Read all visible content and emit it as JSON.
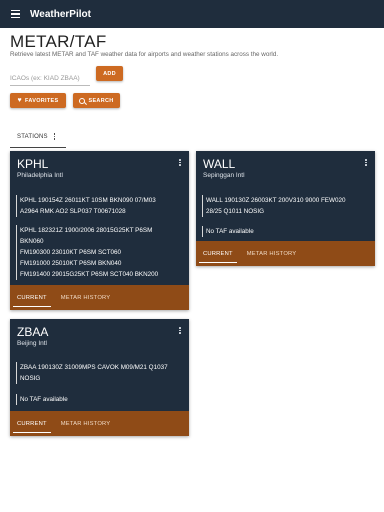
{
  "app": {
    "title": "WeatherPilot"
  },
  "header": {
    "title": "METAR/TAF",
    "subtitle": "Retrieve latest METAR and TAF weather data for airports and weather stations across the world."
  },
  "search": {
    "placeholder": "ICAOs (ex: KIAD ZBAA)",
    "value": ""
  },
  "buttons": {
    "add": "ADD",
    "favorites": "FAVORITES",
    "search": "SEARCH"
  },
  "tabs": {
    "stations": "STATIONS"
  },
  "stations": [
    {
      "code": "KPHL",
      "name": "Philadelphia Intl",
      "metar": "KPHL 190154Z 26011KT 10SM BKN090 07/M03\nA2964 RMK AO2 SLP037 T00671028",
      "taf": "KPHL 182321Z 1900/2006 28015G25KT P6SM\nBKN060\nFM190300 23010KT P6SM SCT060\nFM191000 25010KT P6SM BKN040\nFM191400 29015G25KT P6SM SCT040 BKN200",
      "tab_current": "CURRENT",
      "tab_history": "METAR HISTORY"
    },
    {
      "code": "WALL",
      "name": "Sepinggan Intl",
      "metar": "WALL 190130Z 26003KT 200V310 9000 FEW020\n28/25 Q1011 NOSIG",
      "taf": "No TAF available",
      "tab_current": "CURRENT",
      "tab_history": "METAR HISTORY"
    },
    {
      "code": "ZBAA",
      "name": "Beijing Intl",
      "metar": "ZBAA 190130Z 31009MPS CAVOK M09/M21 Q1037\nNOSIG",
      "taf": "No TAF available",
      "tab_current": "CURRENT",
      "tab_history": "METAR HISTORY"
    }
  ],
  "colors": {
    "appbar": "#1f2d3d",
    "accent": "#cd6a22",
    "card": "#1f2d3d",
    "card_footer": "#8f4b17"
  },
  "icons": {
    "menu": "menu-icon",
    "favorites": "heart-icon",
    "search": "search-icon",
    "more": "more-vert-icon"
  }
}
